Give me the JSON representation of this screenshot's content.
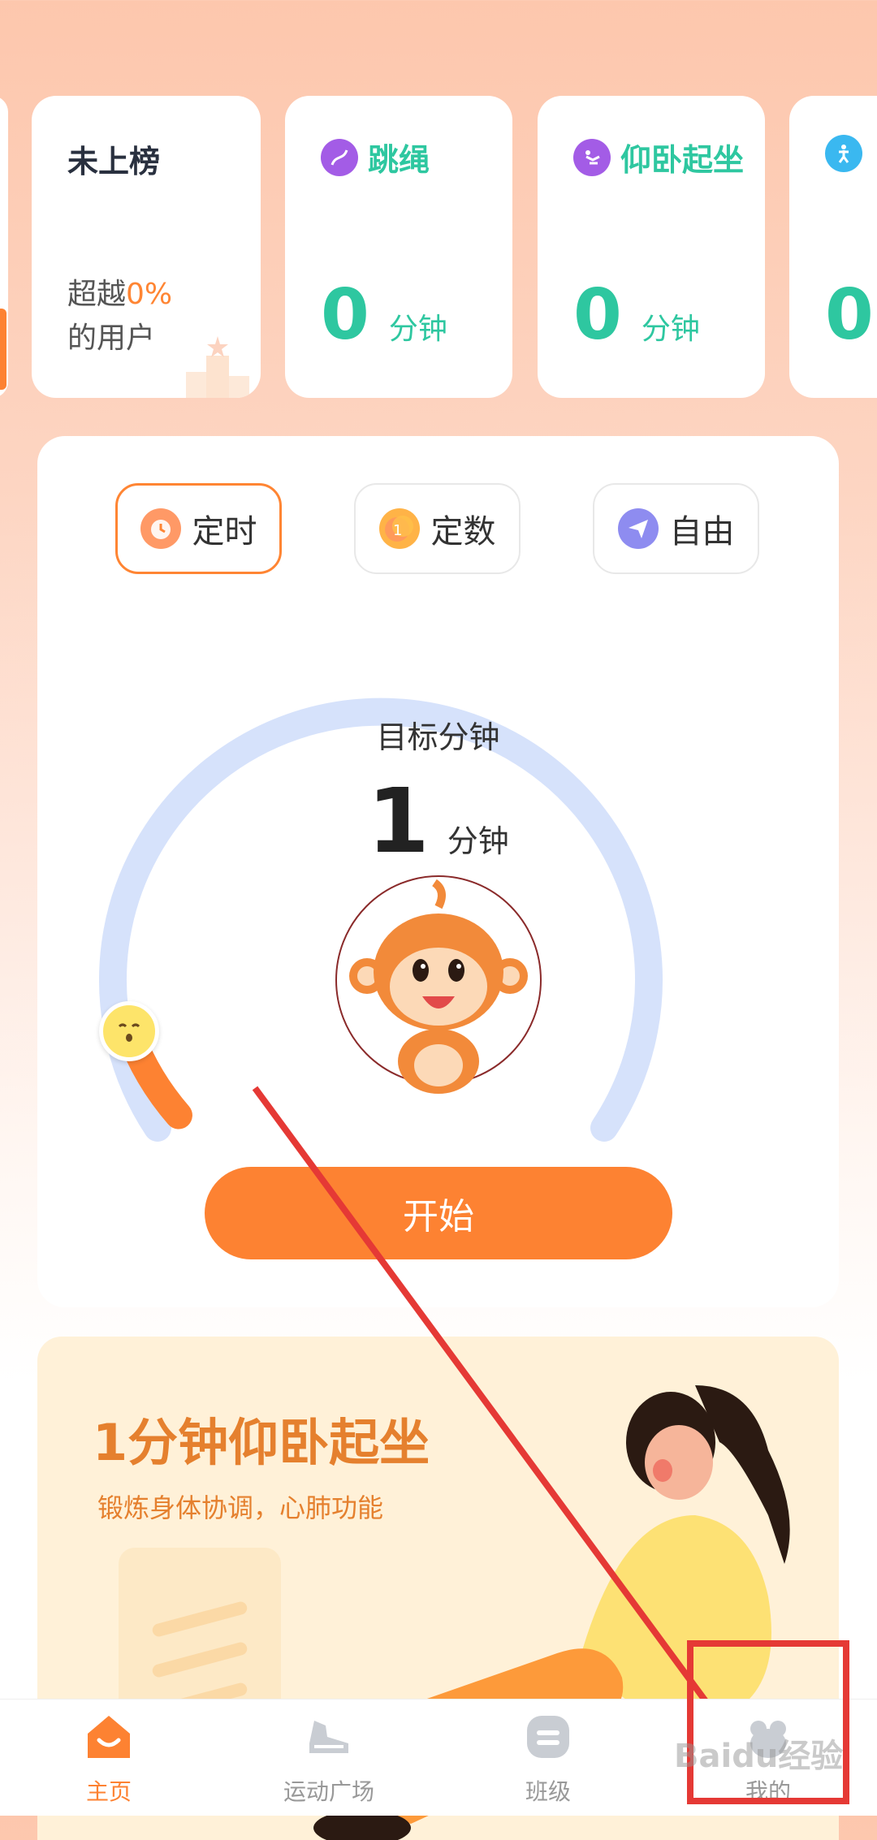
{
  "ranking": {
    "title": "未上榜",
    "sub_prefix": "超越",
    "percent": "0%",
    "sub_suffix": "的用户"
  },
  "sports": [
    {
      "name": "跳绳",
      "value": "0",
      "unit": "分钟",
      "icon": "jump-rope-icon",
      "color": "#a35ce6"
    },
    {
      "name": "仰卧起坐",
      "value": "0",
      "unit": "分钟",
      "icon": "sit-up-icon",
      "color": "#a35ce6"
    },
    {
      "name": "",
      "value": "0",
      "unit": "",
      "icon": "person-icon",
      "color": "#3ab8f0"
    }
  ],
  "modes": [
    {
      "label": "定时",
      "icon": "alarm-clock-icon",
      "active": true
    },
    {
      "label": "定数",
      "icon": "number-coin-icon",
      "active": false
    },
    {
      "label": "自由",
      "icon": "paper-plane-icon",
      "active": false
    }
  ],
  "goal": {
    "label": "目标分钟",
    "value": "1",
    "unit": "分钟",
    "progress_fraction": 0.08
  },
  "start_button": "开始",
  "banner": {
    "title": "1分钟仰卧起坐",
    "subtitle": "锻炼身体协调，心肺功能"
  },
  "tabs": [
    {
      "label": "主页",
      "icon": "home-icon",
      "active": true
    },
    {
      "label": "运动广场",
      "icon": "sneaker-icon",
      "active": false
    },
    {
      "label": "班级",
      "icon": "class-icon",
      "active": false
    },
    {
      "label": "我的",
      "icon": "profile-icon",
      "active": false
    }
  ],
  "watermark": "Baidu经验",
  "colors": {
    "accent": "#fd8232",
    "sport_green": "#2ec7a0",
    "highlight": "#e53935",
    "ring": "#d6e2fb"
  }
}
